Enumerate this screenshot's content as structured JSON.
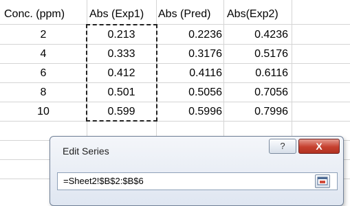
{
  "table": {
    "headers": [
      "Conc. (ppm)",
      "Abs (Exp1)",
      "Abs (Pred)",
      "Abs(Exp2)"
    ],
    "rows": [
      [
        "2",
        "0.213",
        "0.2236",
        "0.4236"
      ],
      [
        "4",
        "0.333",
        "0.3176",
        "0.5176"
      ],
      [
        "6",
        "0.412",
        "0.4116",
        "0.6116"
      ],
      [
        "8",
        "0.501",
        "0.5056",
        "0.7056"
      ],
      [
        "10",
        "0.599",
        "0.5996",
        "0.7996"
      ]
    ]
  },
  "dialog": {
    "title": "Edit Series",
    "help_label": "?",
    "close_label": "X",
    "series_value": "=Sheet2!$B$2:$B$6",
    "collapse_icon": "collapse-dialog-icon"
  },
  "colors": {
    "gridline": "#d4d4d4",
    "close_button": "#c6402f",
    "dialog_border": "#6f7f96"
  }
}
